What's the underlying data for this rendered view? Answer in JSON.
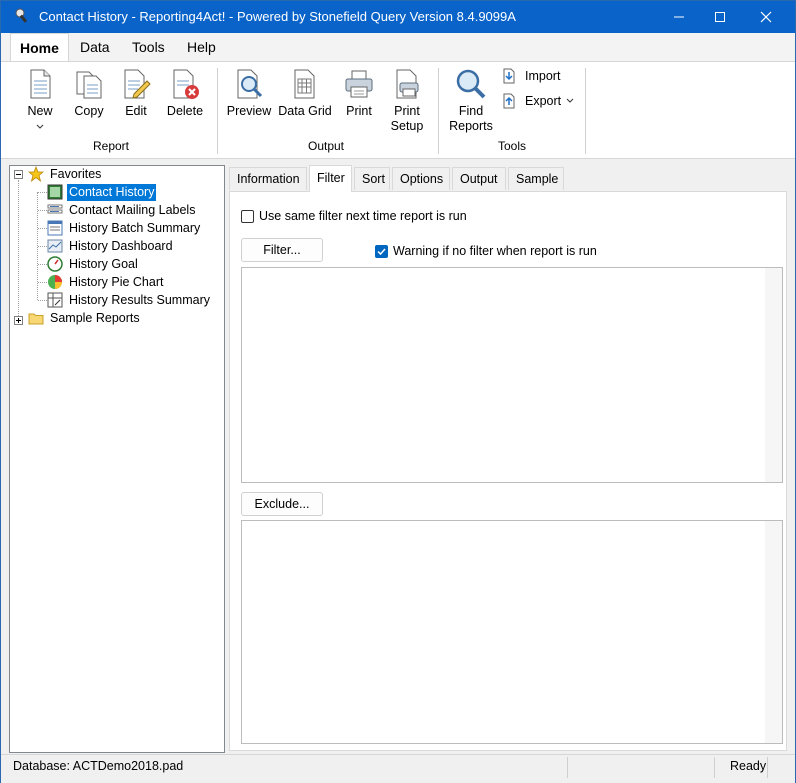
{
  "window": {
    "title": "Contact History - Reporting4Act! - Powered by Stonefield Query Version 8.4.9099A",
    "controls": [
      "minimize-icon",
      "maximize-icon",
      "close-icon"
    ]
  },
  "menu": {
    "items": [
      {
        "label": "Home",
        "active": true
      },
      {
        "label": "Data",
        "active": false
      },
      {
        "label": "Tools",
        "active": false
      },
      {
        "label": "Help",
        "active": false
      }
    ]
  },
  "ribbon": {
    "report": {
      "group_label": "Report",
      "new": "New",
      "copy": "Copy",
      "edit": "Edit",
      "delete": "Delete"
    },
    "output": {
      "group_label": "Output",
      "preview": "Preview",
      "data_grid": "Data Grid",
      "print": "Print",
      "print_setup_1": "Print",
      "print_setup_2": "Setup"
    },
    "tools": {
      "group_label": "Tools",
      "find_1": "Find",
      "find_2": "Reports",
      "import": "Import",
      "export": "Export"
    }
  },
  "tree": {
    "favorites": {
      "label": "Favorites",
      "items": [
        {
          "label": "Contact History",
          "icon": "report-icon",
          "selected": true
        },
        {
          "label": "Contact Mailing Labels",
          "icon": "labels-icon",
          "selected": false
        },
        {
          "label": "History Batch Summary",
          "icon": "form-icon",
          "selected": false
        },
        {
          "label": "History Dashboard",
          "icon": "dashboard-icon",
          "selected": false
        },
        {
          "label": "History Goal",
          "icon": "gauge-icon",
          "selected": false
        },
        {
          "label": "History Pie Chart",
          "icon": "pie-chart-icon",
          "selected": false
        },
        {
          "label": "History Results Summary",
          "icon": "crosstab-icon",
          "selected": false
        }
      ]
    },
    "sample_reports": {
      "label": "Sample Reports"
    }
  },
  "tabs": [
    {
      "label": "Information",
      "active": false
    },
    {
      "label": "Filter",
      "active": true
    },
    {
      "label": "Sort",
      "active": false
    },
    {
      "label": "Options",
      "active": false
    },
    {
      "label": "Output",
      "active": false
    },
    {
      "label": "Sample",
      "active": false
    }
  ],
  "filter_panel": {
    "use_same_filter": {
      "label": "Use same filter next time report is run",
      "checked": false
    },
    "filter_button": "Filter...",
    "warning_no_filter": {
      "label": "Warning if no filter when report is run",
      "checked": true
    },
    "exclude_button": "Exclude..."
  },
  "status": {
    "database": "Database: ACTDemo2018.pad",
    "state": "Ready"
  },
  "colors": {
    "titlebar": "#0a63c9",
    "selection": "#0078d7",
    "checkbox_checked": "#0067c0"
  }
}
